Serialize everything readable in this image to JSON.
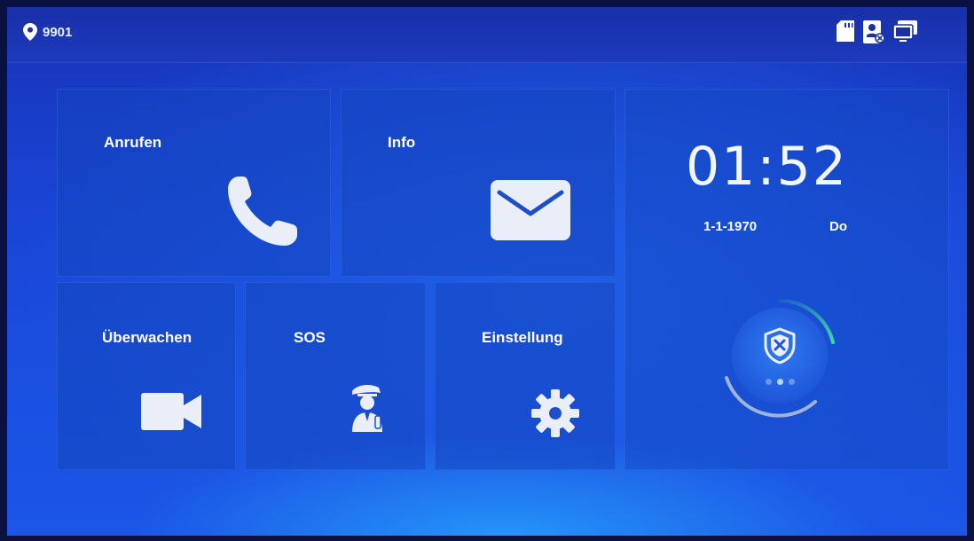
{
  "statusbar": {
    "room_number": "9901",
    "icons": [
      "location-pin-icon",
      "sd-card-icon",
      "door-station-icon",
      "monitor-icon"
    ]
  },
  "tiles": {
    "call": {
      "label": "Anrufen",
      "icon": "phone-icon"
    },
    "info": {
      "label": "Info",
      "icon": "envelope-icon"
    },
    "monitor": {
      "label": "Überwachen",
      "icon": "video-camera-icon"
    },
    "sos": {
      "label": "SOS",
      "icon": "security-guard-icon"
    },
    "settings": {
      "label": "Einstellung",
      "icon": "gear-icon"
    }
  },
  "clock": {
    "time": "01:52",
    "date": "1-1-1970",
    "weekday": "Do"
  },
  "arm": {
    "icon": "shield-icon",
    "page_count": 3,
    "active_page": 2
  },
  "colors": {
    "accent_green": "#3fd9a0",
    "tile_icon": "#e9eef9"
  }
}
